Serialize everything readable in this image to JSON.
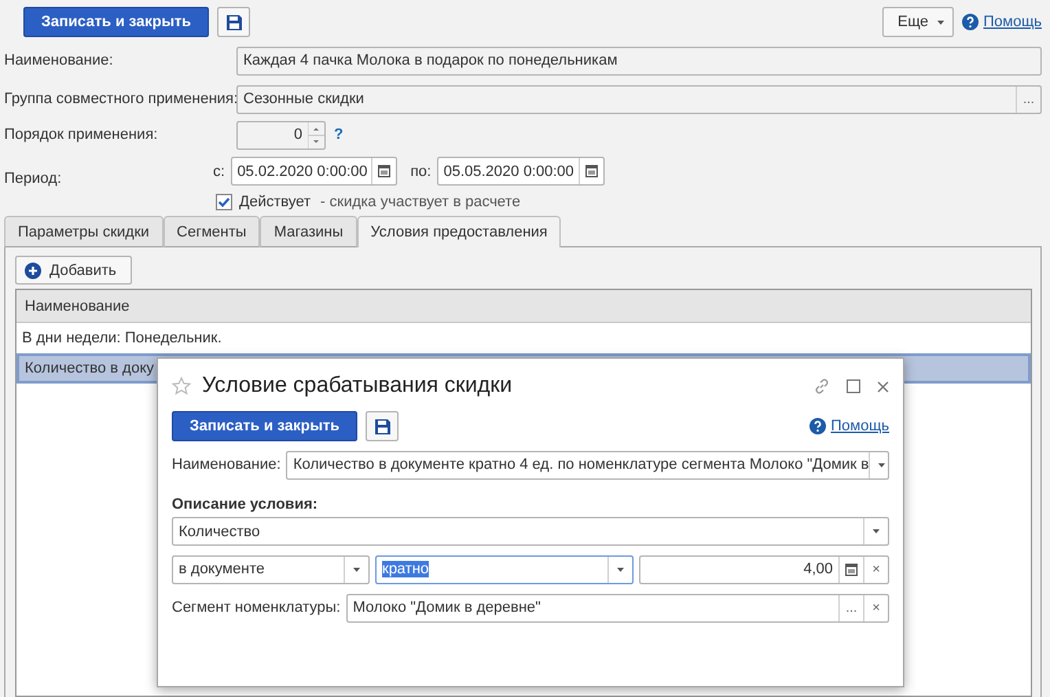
{
  "toolbar": {
    "save_close": "Записать и закрыть",
    "more": "Еще",
    "help": "Помощь"
  },
  "name": {
    "label": "Наименование:",
    "value": "Каждая 4 пачка Молока в подарок по понедельникам"
  },
  "group": {
    "label": "Группа совместного применения:",
    "value": "Сезонные скидки",
    "choose": "..."
  },
  "order": {
    "label": "Порядок применения:",
    "value": "0",
    "hint": "?"
  },
  "period": {
    "label": "Период:",
    "from_label": "с:",
    "from": "05.02.2020  0:00:00",
    "to_label": "по:",
    "to": "05.05.2020  0:00:00"
  },
  "active": {
    "label": "Действует",
    "checked": true,
    "note": "- скидка участвует в расчете"
  },
  "tabs": [
    {
      "label": "Параметры скидки",
      "selected": false
    },
    {
      "label": "Сегменты",
      "selected": false
    },
    {
      "label": "Магазины",
      "selected": false
    },
    {
      "label": "Условия предоставления",
      "selected": true
    }
  ],
  "add_button": "Добавить",
  "table": {
    "columns": [
      "Наименование"
    ],
    "rows": [
      {
        "text": "В дни недели: Понедельник.",
        "selected": false
      },
      {
        "text": "Количество в доку",
        "selected": true
      }
    ]
  },
  "dialog": {
    "title": "Условие срабатывания скидки",
    "save_close": "Записать и закрыть",
    "help": "Помощь",
    "name": {
      "label": "Наименование:",
      "value": "Количество в документе кратно 4 ед. по номенклатуре сегмента Молоко \"Домик в"
    },
    "section": "Описание условия:",
    "condition": "Количество",
    "scope": "в документе",
    "operator": {
      "value": "кратно",
      "focused": true
    },
    "amount": "4,00",
    "clear": "×",
    "segment": {
      "label": "Сегмент номенклатуры:",
      "value": "Молоко \"Домик в деревне\"",
      "choose": "...",
      "clear": "×"
    }
  }
}
